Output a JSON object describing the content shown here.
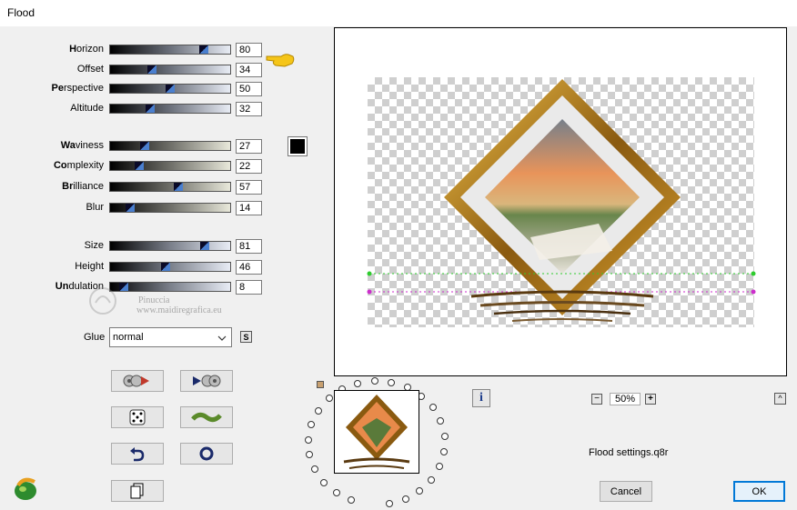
{
  "window": {
    "title": "Flood"
  },
  "sliders_group1": [
    {
      "label": "Horizon",
      "hot": "H",
      "value": "80",
      "pos": 0.8
    },
    {
      "label": "Offset",
      "hot": "",
      "value": "34",
      "pos": 0.34
    },
    {
      "label": "Perspective",
      "hot": "Pe",
      "value": "50",
      "pos": 0.5
    },
    {
      "label": "Altitude",
      "hot": "",
      "value": "32",
      "pos": 0.32
    }
  ],
  "sliders_group2": [
    {
      "label": "Waviness",
      "hot": "Wa",
      "value": "27",
      "pos": 0.27
    },
    {
      "label": "Complexity",
      "hot": "Co",
      "value": "22",
      "pos": 0.22
    },
    {
      "label": "Brilliance",
      "hot": "Br",
      "value": "57",
      "pos": 0.57
    },
    {
      "label": "Blur",
      "hot": "",
      "value": "14",
      "pos": 0.14
    }
  ],
  "sliders_group3": [
    {
      "label": "Size",
      "hot": "",
      "value": "81",
      "pos": 0.81
    },
    {
      "label": "Height",
      "hot": "",
      "value": "46",
      "pos": 0.46
    },
    {
      "label": "Undulation",
      "hot": "Un",
      "value": "8",
      "pos": 0.08
    }
  ],
  "color_swatch": "#000000",
  "glue": {
    "label": "Glue",
    "value": "normal",
    "s_button": "S"
  },
  "watermark": {
    "line1": "Pinuccia",
    "line2": "www.maidiregrafica.eu"
  },
  "zoom": {
    "minus": "−",
    "value": "50%",
    "plus": "+"
  },
  "info_button": "i",
  "up_button": "^",
  "settings_file": "Flood settings.q8r",
  "buttons": {
    "cancel": "Cancel",
    "ok": "OK"
  }
}
